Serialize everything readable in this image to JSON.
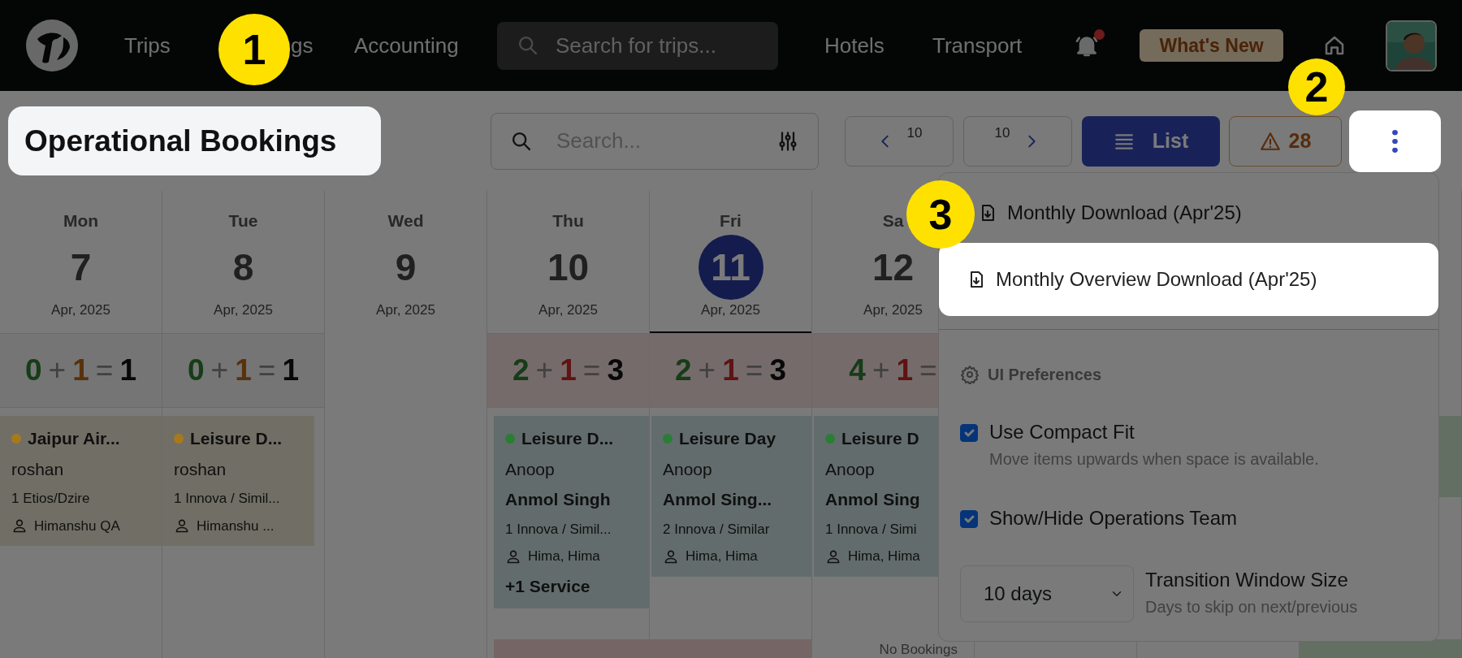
{
  "nav": {
    "links": [
      {
        "label": "Trips"
      },
      {
        "label": "gs"
      },
      {
        "label": "Accounting"
      }
    ],
    "search": {
      "placeholder": "Search for trips..."
    },
    "right_links": [
      {
        "label": "Hotels"
      },
      {
        "label": "Transport"
      }
    ],
    "notifications": {
      "unread": true
    },
    "whats_new": "What's New"
  },
  "toolbar": {
    "title": {
      "text": "Operational Bookings",
      "spotlight": true
    },
    "search": {
      "placeholder": "Search..."
    },
    "prev": {
      "count": "10"
    },
    "next": {
      "count": "10"
    },
    "view_button": {
      "label": "List"
    },
    "alerts": {
      "count": "28"
    },
    "more_button": {
      "spotlight": true
    }
  },
  "days": [
    {
      "day": "Mon",
      "date": "7",
      "month": "Apr, 2025",
      "selected": false,
      "counter": {
        "kind": "normal",
        "parts": [
          {
            "text": "0",
            "kind": "confirmed"
          },
          {
            "text": "+",
            "kind": "op"
          },
          {
            "text": "1",
            "kind": "pending"
          },
          {
            "text": "=",
            "kind": "op"
          },
          {
            "text": "1",
            "kind": "total"
          }
        ]
      },
      "cards": [
        {
          "kind": "pending",
          "color": "#a8791c",
          "title": "Jaipur Air...",
          "name": "roshan",
          "vehicle": "1 Etios/Dzire",
          "staff": "Himanshu QA"
        }
      ]
    },
    {
      "day": "Tue",
      "date": "8",
      "month": "Apr, 2025",
      "selected": false,
      "counter": {
        "kind": "normal",
        "parts": [
          {
            "text": "0",
            "kind": "confirmed"
          },
          {
            "text": "+",
            "kind": "op"
          },
          {
            "text": "1",
            "kind": "pending"
          },
          {
            "text": "=",
            "kind": "op"
          },
          {
            "text": "1",
            "kind": "total"
          }
        ]
      },
      "cards": [
        {
          "kind": "pending",
          "color": "#a8791c",
          "title": "Leisure D...",
          "name": "roshan",
          "vehicle": "1 Innova / Simil...",
          "staff": "Himanshu ..."
        }
      ]
    },
    {
      "day": "Wed",
      "date": "9",
      "month": "Apr, 2025",
      "selected": false
    },
    {
      "day": "Thu",
      "date": "10",
      "month": "Apr, 2025",
      "selected": false,
      "counter": {
        "kind": "alert",
        "parts": [
          {
            "text": "2",
            "kind": "confirmed"
          },
          {
            "text": "+",
            "kind": "op"
          },
          {
            "text": "1",
            "kind": "overdue"
          },
          {
            "text": "=",
            "kind": "op"
          },
          {
            "text": "3",
            "kind": "total"
          }
        ]
      },
      "cards": [
        {
          "kind": "confirmed",
          "color": "#2a7d34",
          "title": "Leisure D...",
          "name": "Anoop",
          "guest": "Anmol Singh",
          "vehicle": "1 Innova / Simil...",
          "staff": "Hima, Hima",
          "extra": "+1 Service"
        },
        {
          "kind": "overdue"
        }
      ]
    },
    {
      "day": "Fri",
      "date": "11",
      "month": "Apr, 2025",
      "selected": true,
      "counter": {
        "kind": "alert",
        "parts": [
          {
            "text": "2",
            "kind": "confirmed"
          },
          {
            "text": "+",
            "kind": "op"
          },
          {
            "text": "1",
            "kind": "overdue"
          },
          {
            "text": "=",
            "kind": "op"
          },
          {
            "text": "3",
            "kind": "total"
          }
        ]
      },
      "cards": [
        {
          "kind": "confirmed",
          "color": "#2a7d34",
          "title": "Leisure Day",
          "name": "Anoop",
          "guest": "Anmol Sing...",
          "vehicle": "2 Innova / Similar",
          "staff": "Hima, Hima"
        },
        {
          "kind": "overdue"
        }
      ]
    },
    {
      "day": "Sa",
      "date": "12",
      "month": "Apr, 2025",
      "selected": false,
      "counter": {
        "kind": "alert",
        "parts": [
          {
            "text": "4",
            "kind": "confirmed"
          },
          {
            "text": "+",
            "kind": "op"
          },
          {
            "text": "1",
            "kind": "overdue"
          },
          {
            "text": "=",
            "kind": "op"
          }
        ]
      },
      "cards": [
        {
          "kind": "confirmed",
          "color": "#2a7d34",
          "title": "Leisure D",
          "name": "Anoop",
          "guest": "Anmol Sing",
          "vehicle": "1 Innova / Simi",
          "staff": "Hima, Hima"
        }
      ],
      "note": "No Bookings"
    }
  ],
  "menu": {
    "items": [
      {
        "label": "Monthly Download (Apr'25)",
        "spotlight": false
      },
      {
        "label": "Monthly Overview Download (Apr'25)",
        "spotlight": true
      }
    ],
    "section": "UI Preferences",
    "options": [
      {
        "kind": "checkbox",
        "label": "Use Compact Fit",
        "hint": "Move items upwards when space is available.",
        "checked": true
      },
      {
        "kind": "checkbox",
        "label": "Show/Hide Operations Team",
        "checked": true
      },
      {
        "kind": "select",
        "value": "10 days",
        "label": "Transition Window Size",
        "hint": "Days to skip on next/previous"
      }
    ]
  },
  "callouts": [
    {
      "number": "1"
    },
    {
      "number": "2"
    },
    {
      "number": "3"
    }
  ]
}
